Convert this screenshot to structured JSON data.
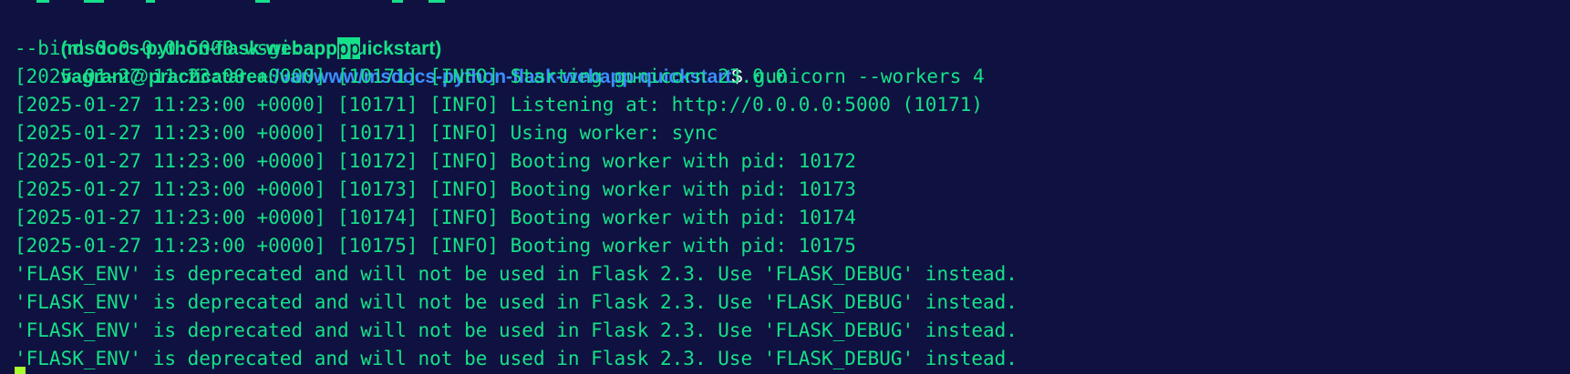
{
  "prompt": {
    "venv": "(msdocs-python-flask-webapp-quickstart)",
    "user_host": "vagrant@practicatarea",
    "path": ":/var/www/msdocs-python-flask-webapp-quickstart",
    "symbol": "$",
    "command_part1": " gunicorn --workers 4",
    "command_part2": "--bind 0.0.0.0:5000 wsgi:app",
    "cursor_text": "pp"
  },
  "output_lines": [
    "[2025-01-27 11:23:00 +0000] [10171] [INFO] Starting gunicorn 23.0.0",
    "[2025-01-27 11:23:00 +0000] [10171] [INFO] Listening at: http://0.0.0.0:5000 (10171)",
    "[2025-01-27 11:23:00 +0000] [10171] [INFO] Using worker: sync",
    "[2025-01-27 11:23:00 +0000] [10172] [INFO] Booting worker with pid: 10172",
    "[2025-01-27 11:23:00 +0000] [10173] [INFO] Booting worker with pid: 10173",
    "[2025-01-27 11:23:00 +0000] [10174] [INFO] Booting worker with pid: 10174",
    "[2025-01-27 11:23:00 +0000] [10175] [INFO] Booting worker with pid: 10175",
    "'FLASK_ENV' is deprecated and will not be used in Flask 2.3. Use 'FLASK_DEBUG' instead.",
    "'FLASK_ENV' is deprecated and will not be used in Flask 2.3. Use 'FLASK_DEBUG' instead.",
    "'FLASK_ENV' is deprecated and will not be used in Flask 2.3. Use 'FLASK_DEBUG' instead.",
    "'FLASK_ENV' is deprecated and will not be used in Flask 2.3. Use 'FLASK_DEBUG' instead."
  ],
  "colors": {
    "background": "#0f1240",
    "text": "#16e089",
    "path": "#3a8fff",
    "cursor": "#a8ff2e"
  }
}
